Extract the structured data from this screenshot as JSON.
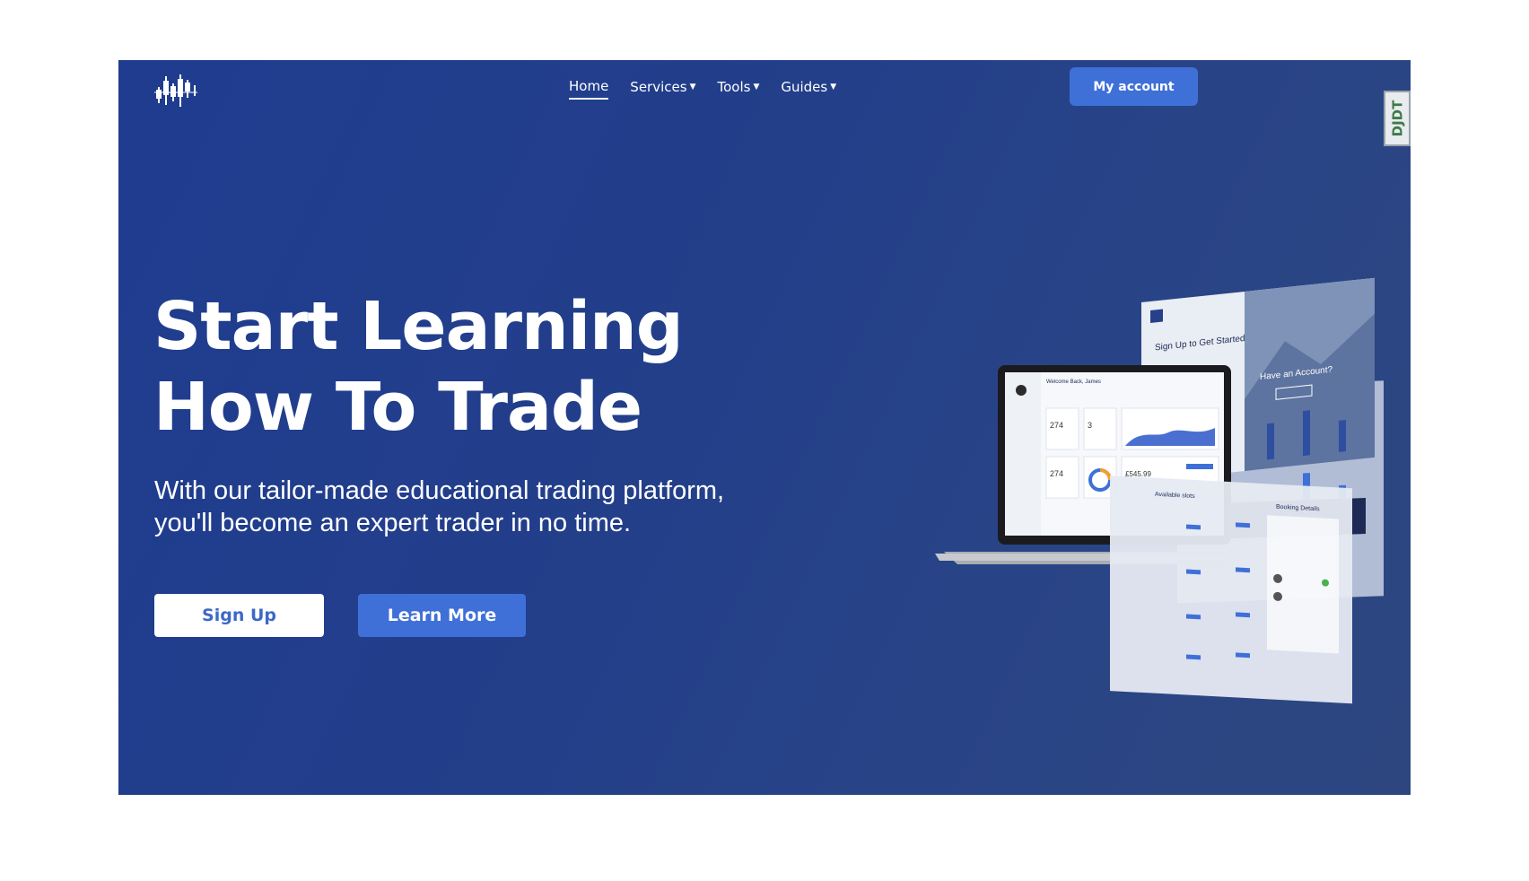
{
  "nav": {
    "items": [
      {
        "label": "Home",
        "active": true,
        "dropdown": false
      },
      {
        "label": "Services",
        "active": false,
        "dropdown": true
      },
      {
        "label": "Tools",
        "active": false,
        "dropdown": true
      },
      {
        "label": "Guides",
        "active": false,
        "dropdown": true
      }
    ],
    "account_label": "My account"
  },
  "debug_toolbar": {
    "label": "DJDT"
  },
  "hero": {
    "title_line1": "Start Learning",
    "title_line2": "How To Trade",
    "subtitle_line1": "With our tailor-made educational trading platform,",
    "subtitle_line2": "you'll become an expert trader in no time.",
    "signup_label": "Sign Up",
    "learn_more_label": "Learn More"
  },
  "mockup": {
    "dashboard_greeting": "Welcome Back, James",
    "stat_1": "274",
    "stat_2": "3",
    "stat_3": "274",
    "balance": "£545.99",
    "signup_card": "Sign Up to Get Started",
    "have_account": "Have an Account?",
    "available_slots": "Available slots",
    "booking_details": "Booking Details"
  },
  "colors": {
    "hero_bg": "#233f8a",
    "accent": "#3f70d8"
  }
}
